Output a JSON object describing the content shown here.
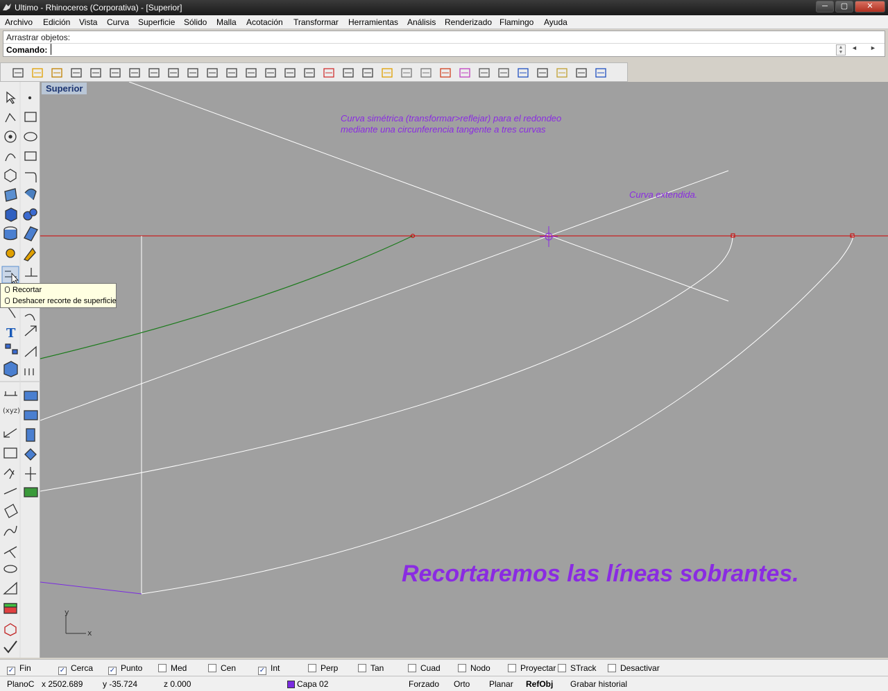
{
  "window": {
    "title": "Ultimo - Rhinoceros (Corporativa) - [Superior]",
    "minimize": "─",
    "maximize": "▢",
    "close": "✕"
  },
  "menu": [
    "Archivo",
    "Edición",
    "Vista",
    "Curva",
    "Superficie",
    "Sólido",
    "Malla",
    "Acotación",
    "Transformar",
    "Herramientas",
    "Análisis",
    "Renderizado",
    "Flamingo",
    "Ayuda"
  ],
  "command": {
    "history": "Arrastrar objetos:",
    "prompt": "Comando:",
    "value": "",
    "arrow_left": "◄",
    "arrow_right": "►"
  },
  "viewport": {
    "label": "Superior",
    "annotation_1_line1": "Curva simétrica (transformar>reflejar) para el redondeo",
    "annotation_1_line2": "mediante una circunferencia tangente a tres curvas",
    "annotation_2": "Curva extendida.",
    "big_annotation": "Recortaremos las líneas sobrantes.",
    "axis_x": "x",
    "axis_y": "y",
    "colors": {
      "background": "#a0a0a0",
      "white_curve": "#ffffff",
      "red_line": "#d00000",
      "green_curve": "#1a7a1a",
      "purple_curve": "#7a2be0",
      "annotation": "#8a2be2"
    }
  },
  "tooltip": {
    "line1": "Recortar",
    "line2": "Deshacer recorte de superficie"
  },
  "osnaps": [
    {
      "label": "Fin",
      "checked": true
    },
    {
      "label": "Cerca",
      "checked": true
    },
    {
      "label": "Punto",
      "checked": true
    },
    {
      "label": "Med",
      "checked": false
    },
    {
      "label": "Cen",
      "checked": false
    },
    {
      "label": "Int",
      "checked": true
    },
    {
      "label": "Perp",
      "checked": false
    },
    {
      "label": "Tan",
      "checked": false
    },
    {
      "label": "Cuad",
      "checked": false
    },
    {
      "label": "Nodo",
      "checked": false
    },
    {
      "label": "Proyectar",
      "checked": false
    },
    {
      "label": "STrack",
      "checked": false
    },
    {
      "label": "Desactivar",
      "checked": false
    }
  ],
  "status": {
    "plane": "PlanoC",
    "x": "x 2502.689",
    "y": "y -35.724",
    "z": "z 0.000",
    "layer": "Capa 02",
    "layer_color": "#7a2be0",
    "forzado": "Forzado",
    "orto": "Orto",
    "planar": "Planar",
    "refobj": "RefObj",
    "history": "Grabar historial"
  },
  "toolbar_icons": [
    "new-icon",
    "open-icon",
    "save-icon",
    "print-icon",
    "import-icon",
    "cut-icon",
    "copy-icon",
    "paste-icon",
    "undo-icon",
    "pan-icon",
    "rotate-view-icon",
    "zoom-icon",
    "zoom-window-icon",
    "zoom-extents-icon",
    "rotate-icon",
    "move-icon",
    "car-icon",
    "grid-icon",
    "snap-icon",
    "light-icon",
    "cube-shade-icon",
    "box-icon",
    "layers-icon",
    "color-wheel-icon",
    "display-icon",
    "render-icon",
    "render-preview-icon",
    "material-icon",
    "sun-icon",
    "options-icon",
    "help-icon"
  ]
}
